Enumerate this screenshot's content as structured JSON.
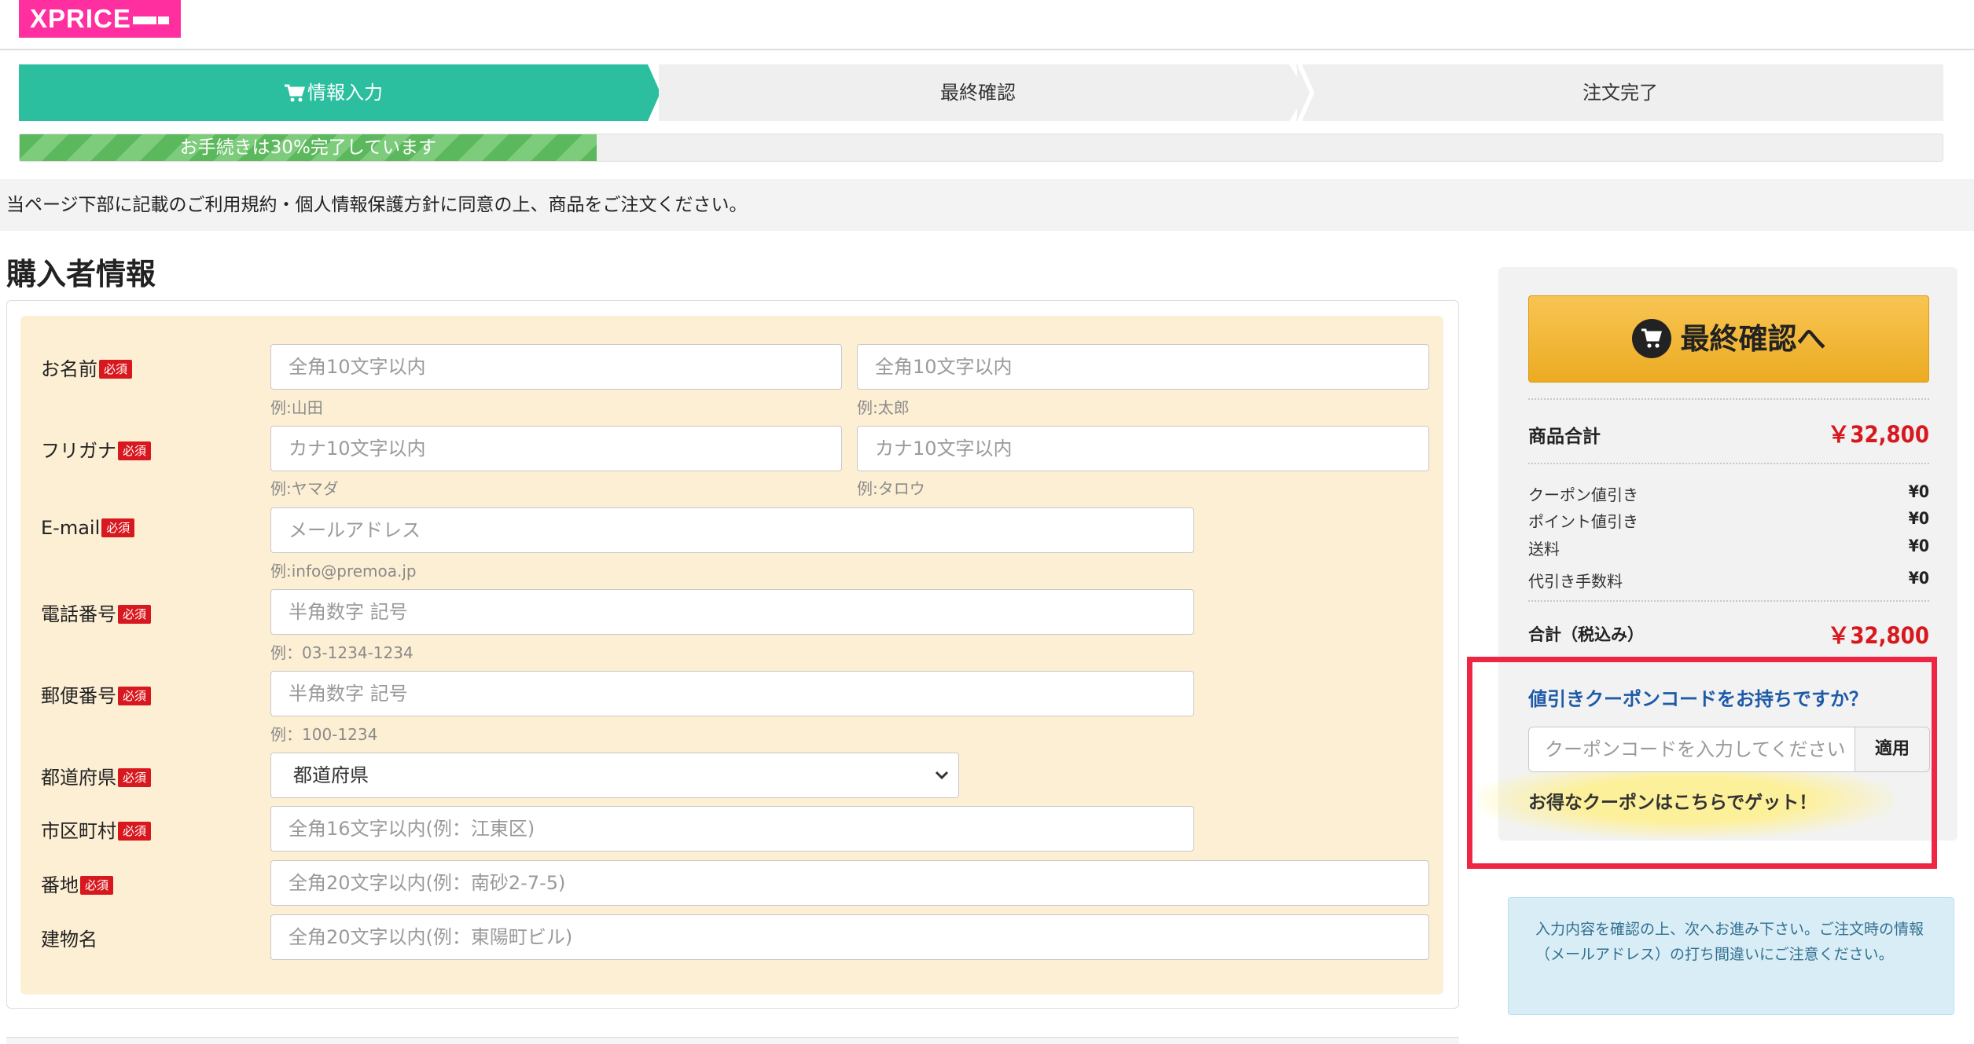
{
  "logo": {
    "text": "XPRICE"
  },
  "steps": [
    {
      "label": "情報入力"
    },
    {
      "label": "最終確認"
    },
    {
      "label": "注文完了"
    }
  ],
  "progress": {
    "percent": 30,
    "label": "お手続きは30%完了しています"
  },
  "notice": "当ページ下部に記載のご利用規約・個人情報保護方針に同意の上、商品をご注文ください。",
  "section_title": "購入者情報",
  "required_badge": "必須",
  "form": {
    "name": {
      "label": "お名前",
      "last_placeholder": "全角10文字以内",
      "first_placeholder": "全角10文字以内",
      "last_example": "例:山田",
      "first_example": "例:太郎"
    },
    "kana": {
      "label": "フリガナ",
      "last_placeholder": "カナ10文字以内",
      "first_placeholder": "カナ10文字以内",
      "last_example": "例:ヤマダ",
      "first_example": "例:タロウ"
    },
    "email": {
      "label": "E-mail",
      "placeholder": "メールアドレス",
      "example": "例:info@premoa.jp"
    },
    "phone": {
      "label": "電話番号",
      "placeholder": "半角数字 記号",
      "example": "例：03-1234-1234"
    },
    "postal": {
      "label": "郵便番号",
      "placeholder": "半角数字 記号",
      "example": "例：100-1234"
    },
    "prefecture": {
      "label": "都道府県",
      "selected": "都道府県"
    },
    "city": {
      "label": "市区町村",
      "placeholder": "全角16文字以内(例：江東区)"
    },
    "address": {
      "label": "番地",
      "placeholder": "全角20文字以内(例：南砂2-7-5)"
    },
    "building": {
      "label": "建物名",
      "placeholder": "全角20文字以内(例：東陽町ビル)"
    }
  },
  "sidebar": {
    "cta_label": "最終確認へ",
    "subtotal_label": "商品合計",
    "subtotal_value": "￥32,800",
    "rows": [
      {
        "label": "クーポン値引き",
        "value": "¥0"
      },
      {
        "label": "ポイント値引き",
        "value": "¥0"
      },
      {
        "label": "送料",
        "value": "¥0"
      },
      {
        "label": "代引き手数料",
        "value": "¥0"
      }
    ],
    "total_label": "合計（税込み）",
    "total_value": "￥32,800",
    "coupon_question": "値引きクーポンコードをお持ちですか？",
    "coupon_placeholder": "クーポンコードを入力してください",
    "coupon_apply": "適用",
    "coupon_link": "お得なクーポンはこちらでゲット！",
    "info": "入力内容を確認の上、次へお進み下さい。ご注文時の情報（メールアドレス）の打ち間違いにご注意ください。"
  },
  "colors": {
    "brand": "#ff2fa0",
    "step_active": "#2bbf9f",
    "progress": "#5cb85c",
    "form_bg": "#fdefd4",
    "required": "#d8181f",
    "cta": "#f0b43a",
    "highlight_box": "#ee2644",
    "coupon_link": "#1d5aa8"
  }
}
